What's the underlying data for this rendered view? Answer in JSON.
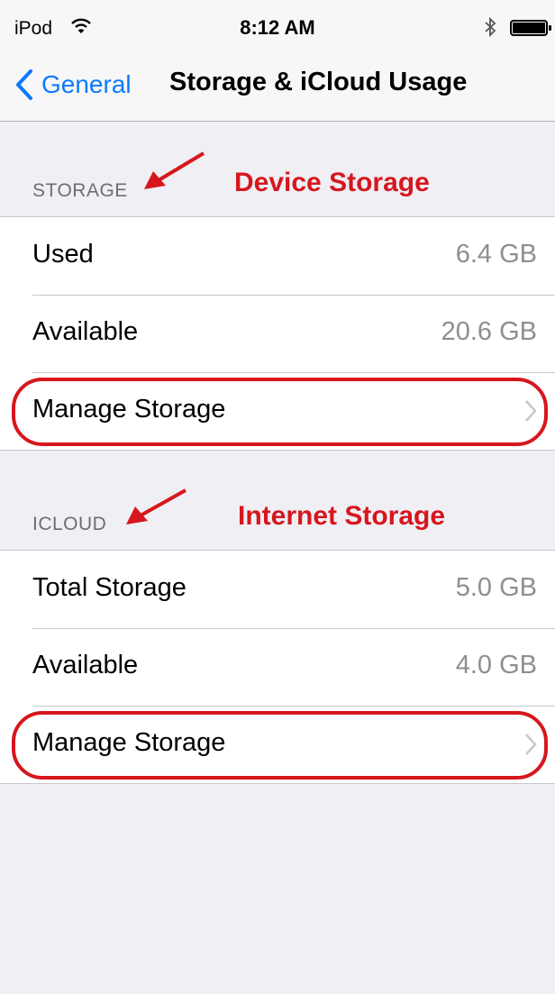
{
  "status_bar": {
    "carrier": "iPod",
    "time": "8:12 AM"
  },
  "nav": {
    "back_label": "General",
    "title": "Storage & iCloud Usage"
  },
  "storage": {
    "header": "STORAGE",
    "annotation": "Device Storage",
    "used_label": "Used",
    "used_value": "6.4 GB",
    "available_label": "Available",
    "available_value": "20.6 GB",
    "manage_label": "Manage Storage"
  },
  "icloud": {
    "header": "ICLOUD",
    "annotation": "Internet Storage",
    "total_label": "Total Storage",
    "total_value": "5.0 GB",
    "available_label": "Available",
    "available_value": "4.0 GB",
    "manage_label": "Manage Storage"
  },
  "colors": {
    "accent": "#0a7aff",
    "annotation": "#d7161d",
    "background": "#efeff4"
  },
  "icons": [
    "wifi-icon",
    "bluetooth-icon",
    "battery-icon",
    "back-chevron-icon",
    "chevron-right-icon",
    "arrow-icon"
  ]
}
